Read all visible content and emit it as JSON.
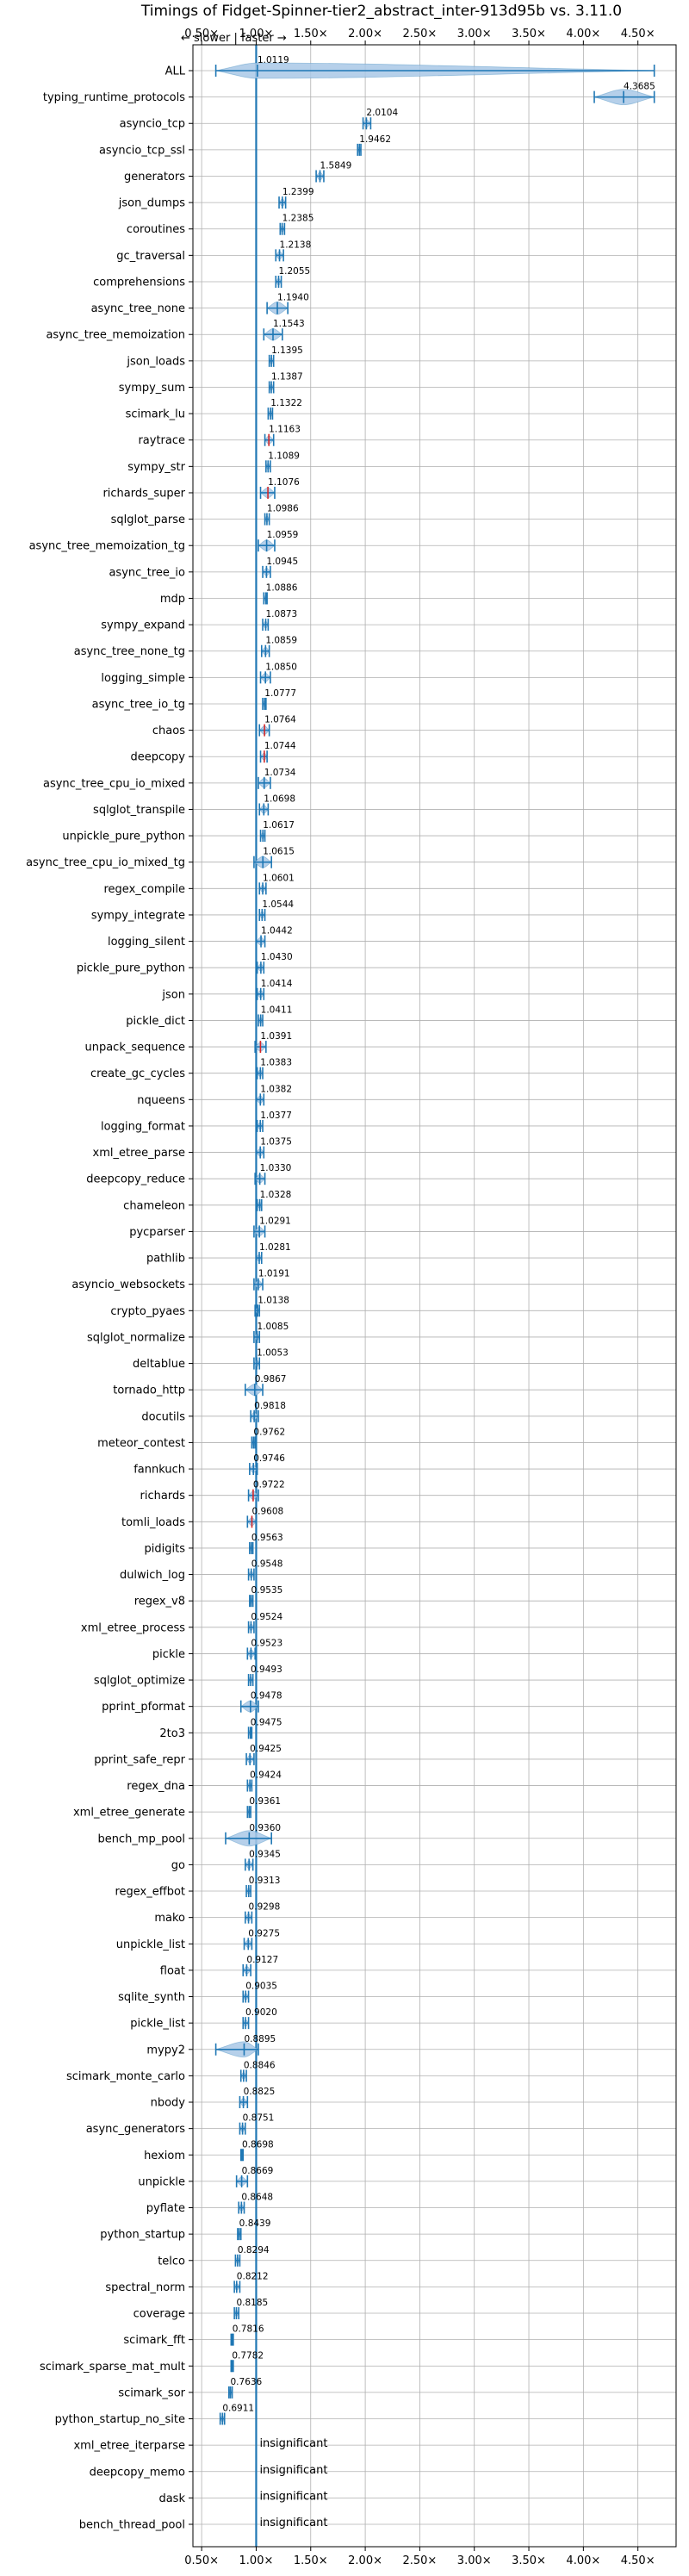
{
  "chart_data": {
    "type": "violin",
    "title": "Timings of Fidget-Spinner-tier2_abstract_inter-913d95b vs. 3.11.0",
    "direction_note": "← slower | faster →",
    "xlim": [
      0.42,
      4.85
    ],
    "reference_x": 1.0,
    "grid": true,
    "x_ticks": [
      0.5,
      1.0,
      1.5,
      2.0,
      2.5,
      3.0,
      3.5,
      4.0,
      4.5
    ],
    "x_tick_labels": [
      "0.50×",
      "1.00×",
      "1.50×",
      "2.00×",
      "2.50×",
      "3.00×",
      "3.50×",
      "4.00×",
      "4.50×"
    ],
    "insignificant_text": "insignificant",
    "categories": [
      "ALL",
      "typing_runtime_protocols",
      "asyncio_tcp",
      "asyncio_tcp_ssl",
      "generators",
      "json_dumps",
      "coroutines",
      "gc_traversal",
      "comprehensions",
      "async_tree_none",
      "async_tree_memoization",
      "json_loads",
      "sympy_sum",
      "scimark_lu",
      "raytrace",
      "sympy_str",
      "richards_super",
      "sqlglot_parse",
      "async_tree_memoization_tg",
      "async_tree_io",
      "mdp",
      "sympy_expand",
      "async_tree_none_tg",
      "logging_simple",
      "async_tree_io_tg",
      "chaos",
      "deepcopy",
      "async_tree_cpu_io_mixed",
      "sqlglot_transpile",
      "unpickle_pure_python",
      "async_tree_cpu_io_mixed_tg",
      "regex_compile",
      "sympy_integrate",
      "logging_silent",
      "pickle_pure_python",
      "json",
      "pickle_dict",
      "unpack_sequence",
      "create_gc_cycles",
      "nqueens",
      "logging_format",
      "xml_etree_parse",
      "deepcopy_reduce",
      "chameleon",
      "pycparser",
      "pathlib",
      "asyncio_websockets",
      "crypto_pyaes",
      "sqlglot_normalize",
      "deltablue",
      "tornado_http",
      "docutils",
      "meteor_contest",
      "fannkuch",
      "richards",
      "tomli_loads",
      "pidigits",
      "dulwich_log",
      "regex_v8",
      "xml_etree_process",
      "pickle",
      "sqlglot_optimize",
      "pprint_pformat",
      "2to3",
      "pprint_safe_repr",
      "regex_dna",
      "xml_etree_generate",
      "bench_mp_pool",
      "go",
      "regex_effbot",
      "mako",
      "unpickle_list",
      "float",
      "sqlite_synth",
      "pickle_list",
      "mypy2",
      "scimark_monte_carlo",
      "nbody",
      "async_generators",
      "hexiom",
      "unpickle",
      "pyflate",
      "python_startup",
      "telco",
      "spectral_norm",
      "coverage",
      "scimark_fft",
      "scimark_sparse_mat_mult",
      "scimark_sor",
      "python_startup_no_site",
      "xml_etree_iterparse",
      "deepcopy_memo",
      "dask",
      "bench_thread_pool"
    ],
    "values": [
      1.0119,
      4.3685,
      2.0104,
      1.9462,
      1.5849,
      1.2399,
      1.2385,
      1.2138,
      1.2055,
      1.194,
      1.1543,
      1.1395,
      1.1387,
      1.1322,
      1.1163,
      1.1089,
      1.1076,
      1.0986,
      1.0959,
      1.0945,
      1.0886,
      1.0873,
      1.0859,
      1.085,
      1.0777,
      1.0764,
      1.0744,
      1.0734,
      1.0698,
      1.0617,
      1.0615,
      1.0601,
      1.0544,
      1.0442,
      1.043,
      1.0414,
      1.0411,
      1.0391,
      1.0383,
      1.0382,
      1.0377,
      1.0375,
      1.033,
      1.0328,
      1.0291,
      1.0281,
      1.0191,
      1.0138,
      1.0085,
      1.0053,
      0.9867,
      0.9818,
      0.9762,
      0.9746,
      0.9722,
      0.9608,
      0.9563,
      0.9548,
      0.9535,
      0.9524,
      0.9523,
      0.9493,
      0.9478,
      0.9475,
      0.9425,
      0.9424,
      0.9361,
      0.936,
      0.9345,
      0.9313,
      0.9298,
      0.9275,
      0.9127,
      0.9035,
      0.902,
      0.8895,
      0.8846,
      0.8825,
      0.8751,
      0.8698,
      0.8669,
      0.8648,
      0.8439,
      0.8294,
      0.8212,
      0.8185,
      0.7816,
      0.7782,
      0.7636,
      0.6911,
      null,
      null,
      null,
      null
    ],
    "value_labels": [
      "1.0119",
      "4.3685",
      "2.0104",
      "1.9462",
      "1.5849",
      "1.2399",
      "1.2385",
      "1.2138",
      "1.2055",
      "1.1940",
      "1.1543",
      "1.1395",
      "1.1387",
      "1.1322",
      "1.1163",
      "1.1089",
      "1.1076",
      "1.0986",
      "1.0959",
      "1.0945",
      "1.0886",
      "1.0873",
      "1.0859",
      "1.0850",
      "1.0777",
      "1.0764",
      "1.0744",
      "1.0734",
      "1.0698",
      "1.0617",
      "1.0615",
      "1.0601",
      "1.0544",
      "1.0442",
      "1.0430",
      "1.0414",
      "1.0411",
      "1.0391",
      "1.0383",
      "1.0382",
      "1.0377",
      "1.0375",
      "1.0330",
      "1.0328",
      "1.0291",
      "1.0281",
      "1.0191",
      "1.0138",
      "1.0085",
      "1.0053",
      "0.9867",
      "0.9818",
      "0.9762",
      "0.9746",
      "0.9722",
      "0.9608",
      "0.9563",
      "0.9548",
      "0.9535",
      "0.9524",
      "0.9523",
      "0.9493",
      "0.9478",
      "0.9475",
      "0.9425",
      "0.9424",
      "0.9361",
      "0.9360",
      "0.9345",
      "0.9313",
      "0.9298",
      "0.9275",
      "0.9127",
      "0.9035",
      "0.9020",
      "0.8895",
      "0.8846",
      "0.8825",
      "0.8751",
      "0.8698",
      "0.8669",
      "0.8648",
      "0.8439",
      "0.8294",
      "0.8212",
      "0.8185",
      "0.7816",
      "0.7782",
      "0.7636",
      "0.6911",
      "",
      "",
      "",
      ""
    ],
    "ranges": [
      [
        0.63,
        4.65
      ],
      [
        4.1,
        4.65
      ],
      [
        1.98,
        2.05
      ],
      [
        1.93,
        1.96
      ],
      [
        1.55,
        1.62
      ],
      [
        1.21,
        1.27
      ],
      [
        1.22,
        1.26
      ],
      [
        1.18,
        1.25
      ],
      [
        1.18,
        1.23
      ],
      [
        1.1,
        1.29
      ],
      [
        1.07,
        1.24
      ],
      [
        1.12,
        1.16
      ],
      [
        1.12,
        1.16
      ],
      [
        1.11,
        1.15
      ],
      [
        1.08,
        1.16
      ],
      [
        1.09,
        1.13
      ],
      [
        1.04,
        1.17
      ],
      [
        1.08,
        1.12
      ],
      [
        1.02,
        1.17
      ],
      [
        1.06,
        1.13
      ],
      [
        1.07,
        1.1
      ],
      [
        1.06,
        1.11
      ],
      [
        1.05,
        1.12
      ],
      [
        1.04,
        1.13
      ],
      [
        1.06,
        1.09
      ],
      [
        1.03,
        1.12
      ],
      [
        1.04,
        1.1
      ],
      [
        1.02,
        1.13
      ],
      [
        1.03,
        1.11
      ],
      [
        1.04,
        1.08
      ],
      [
        0.98,
        1.14
      ],
      [
        1.03,
        1.09
      ],
      [
        1.03,
        1.08
      ],
      [
        1.0,
        1.08
      ],
      [
        1.01,
        1.07
      ],
      [
        1.01,
        1.07
      ],
      [
        1.02,
        1.06
      ],
      [
        0.99,
        1.09
      ],
      [
        1.01,
        1.06
      ],
      [
        1.0,
        1.07
      ],
      [
        1.01,
        1.06
      ],
      [
        1.0,
        1.07
      ],
      [
        0.99,
        1.08
      ],
      [
        1.01,
        1.05
      ],
      [
        0.98,
        1.08
      ],
      [
        1.0,
        1.05
      ],
      [
        0.98,
        1.06
      ],
      [
        0.99,
        1.03
      ],
      [
        0.98,
        1.03
      ],
      [
        0.98,
        1.03
      ],
      [
        0.9,
        1.06
      ],
      [
        0.95,
        1.02
      ],
      [
        0.96,
        0.99
      ],
      [
        0.94,
        1.01
      ],
      [
        0.93,
        1.02
      ],
      [
        0.92,
        1.0
      ],
      [
        0.94,
        0.97
      ],
      [
        0.93,
        0.98
      ],
      [
        0.94,
        0.97
      ],
      [
        0.93,
        0.98
      ],
      [
        0.92,
        0.99
      ],
      [
        0.93,
        0.97
      ],
      [
        0.86,
        1.02
      ],
      [
        0.93,
        0.96
      ],
      [
        0.91,
        0.98
      ],
      [
        0.92,
        0.96
      ],
      [
        0.92,
        0.95
      ],
      [
        0.72,
        1.14
      ],
      [
        0.9,
        0.97
      ],
      [
        0.91,
        0.95
      ],
      [
        0.9,
        0.96
      ],
      [
        0.89,
        0.96
      ],
      [
        0.88,
        0.95
      ],
      [
        0.88,
        0.93
      ],
      [
        0.88,
        0.93
      ],
      [
        0.63,
        1.02
      ],
      [
        0.86,
        0.91
      ],
      [
        0.85,
        0.92
      ],
      [
        0.85,
        0.9
      ],
      [
        0.86,
        0.88
      ],
      [
        0.82,
        0.92
      ],
      [
        0.84,
        0.89
      ],
      [
        0.83,
        0.86
      ],
      [
        0.81,
        0.85
      ],
      [
        0.8,
        0.85
      ],
      [
        0.8,
        0.84
      ],
      [
        0.77,
        0.79
      ],
      [
        0.77,
        0.79
      ],
      [
        0.75,
        0.78
      ],
      [
        0.67,
        0.71
      ],
      null,
      null,
      null,
      null
    ],
    "red_mean_categories": [
      "raytrace",
      "richards_super",
      "chaos",
      "deepcopy",
      "unpack_sequence",
      "richards",
      "tomli_loads"
    ],
    "colors": {
      "violin": "#1f77b4",
      "violin_fill": "#a9c8e6",
      "mean_marker": "#d62728",
      "grid": "#b0b0b0",
      "axis": "#000000"
    }
  }
}
